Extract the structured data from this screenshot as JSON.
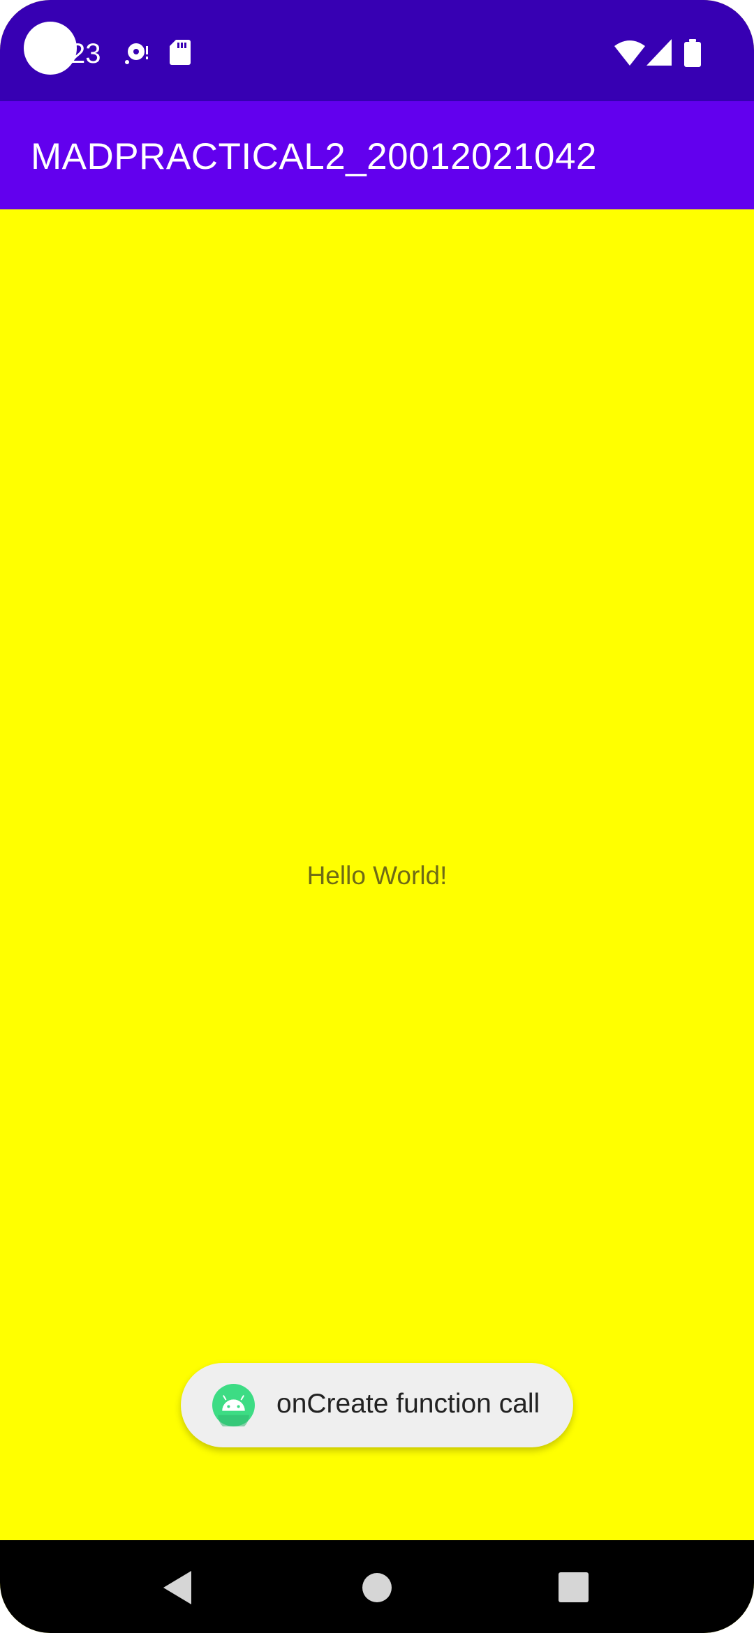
{
  "status_bar": {
    "time": "23",
    "icons": [
      "camera-dot",
      "sync-icon",
      "sd-card-icon",
      "wifi-icon",
      "cell-signal-icon",
      "battery-icon"
    ],
    "background": "#3700b3"
  },
  "app_bar": {
    "title": "MADPRACTICAL2_20012021042",
    "background": "#6200ee"
  },
  "main": {
    "hello_text": "Hello World!",
    "background": "#ffff00"
  },
  "toast": {
    "message": "onCreate function call",
    "icon": "android-icon"
  },
  "nav_bar": {
    "buttons": [
      "back-icon",
      "home-icon",
      "recents-icon"
    ],
    "background": "#000000"
  }
}
